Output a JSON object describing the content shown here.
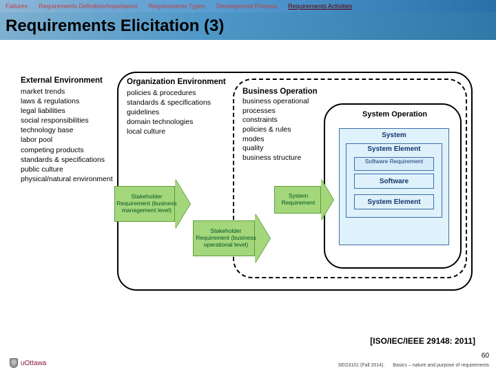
{
  "nav": {
    "items": [
      {
        "label": "Failures",
        "active": false
      },
      {
        "label": "Requirements Definition/Importance",
        "active": false
      },
      {
        "label": "Requirements Types",
        "active": false
      },
      {
        "label": "Development Process",
        "active": false
      },
      {
        "label": "Requirements Activities",
        "active": true
      }
    ]
  },
  "title": "Requirements Elicitation (3)",
  "external_env": {
    "header": "External Environment",
    "items": [
      "market trends",
      "laws & regulations",
      "legal liabilities",
      "social responsibilities",
      "technology base",
      "labor pool",
      "competing products",
      "standards & specifications",
      "public culture",
      "physical/natural environment"
    ]
  },
  "org_env": {
    "header": "Organization Environment",
    "items": [
      "policies & procedures",
      "standards & specifications",
      "guidelines",
      "domain technologies",
      "local culture"
    ]
  },
  "biz_op": {
    "header": "Business Operation",
    "items": [
      "business operational processes",
      "constraints",
      "policies & rules",
      "modes",
      "quality",
      "business structure"
    ]
  },
  "system_op_label": "System Operation",
  "boxes": {
    "system": "System",
    "sys_elem_a": "System Element",
    "software_req": "Software Requirement",
    "software": "Software",
    "sys_elem_b": "System Element"
  },
  "arrows": {
    "a1": "Stakeholder Requirement (business management level)",
    "a2": "Stakeholder Requirement (business operational level)",
    "a3": "System Requirement"
  },
  "citation": "[ISO/IEC/IEEE 29148: 2011]",
  "page_number": "60",
  "footer": {
    "course": "SEG3101 (Fall 2014).",
    "topic": "Basics – nature and purpose of requirements"
  },
  "logo_text": "uOttawa"
}
